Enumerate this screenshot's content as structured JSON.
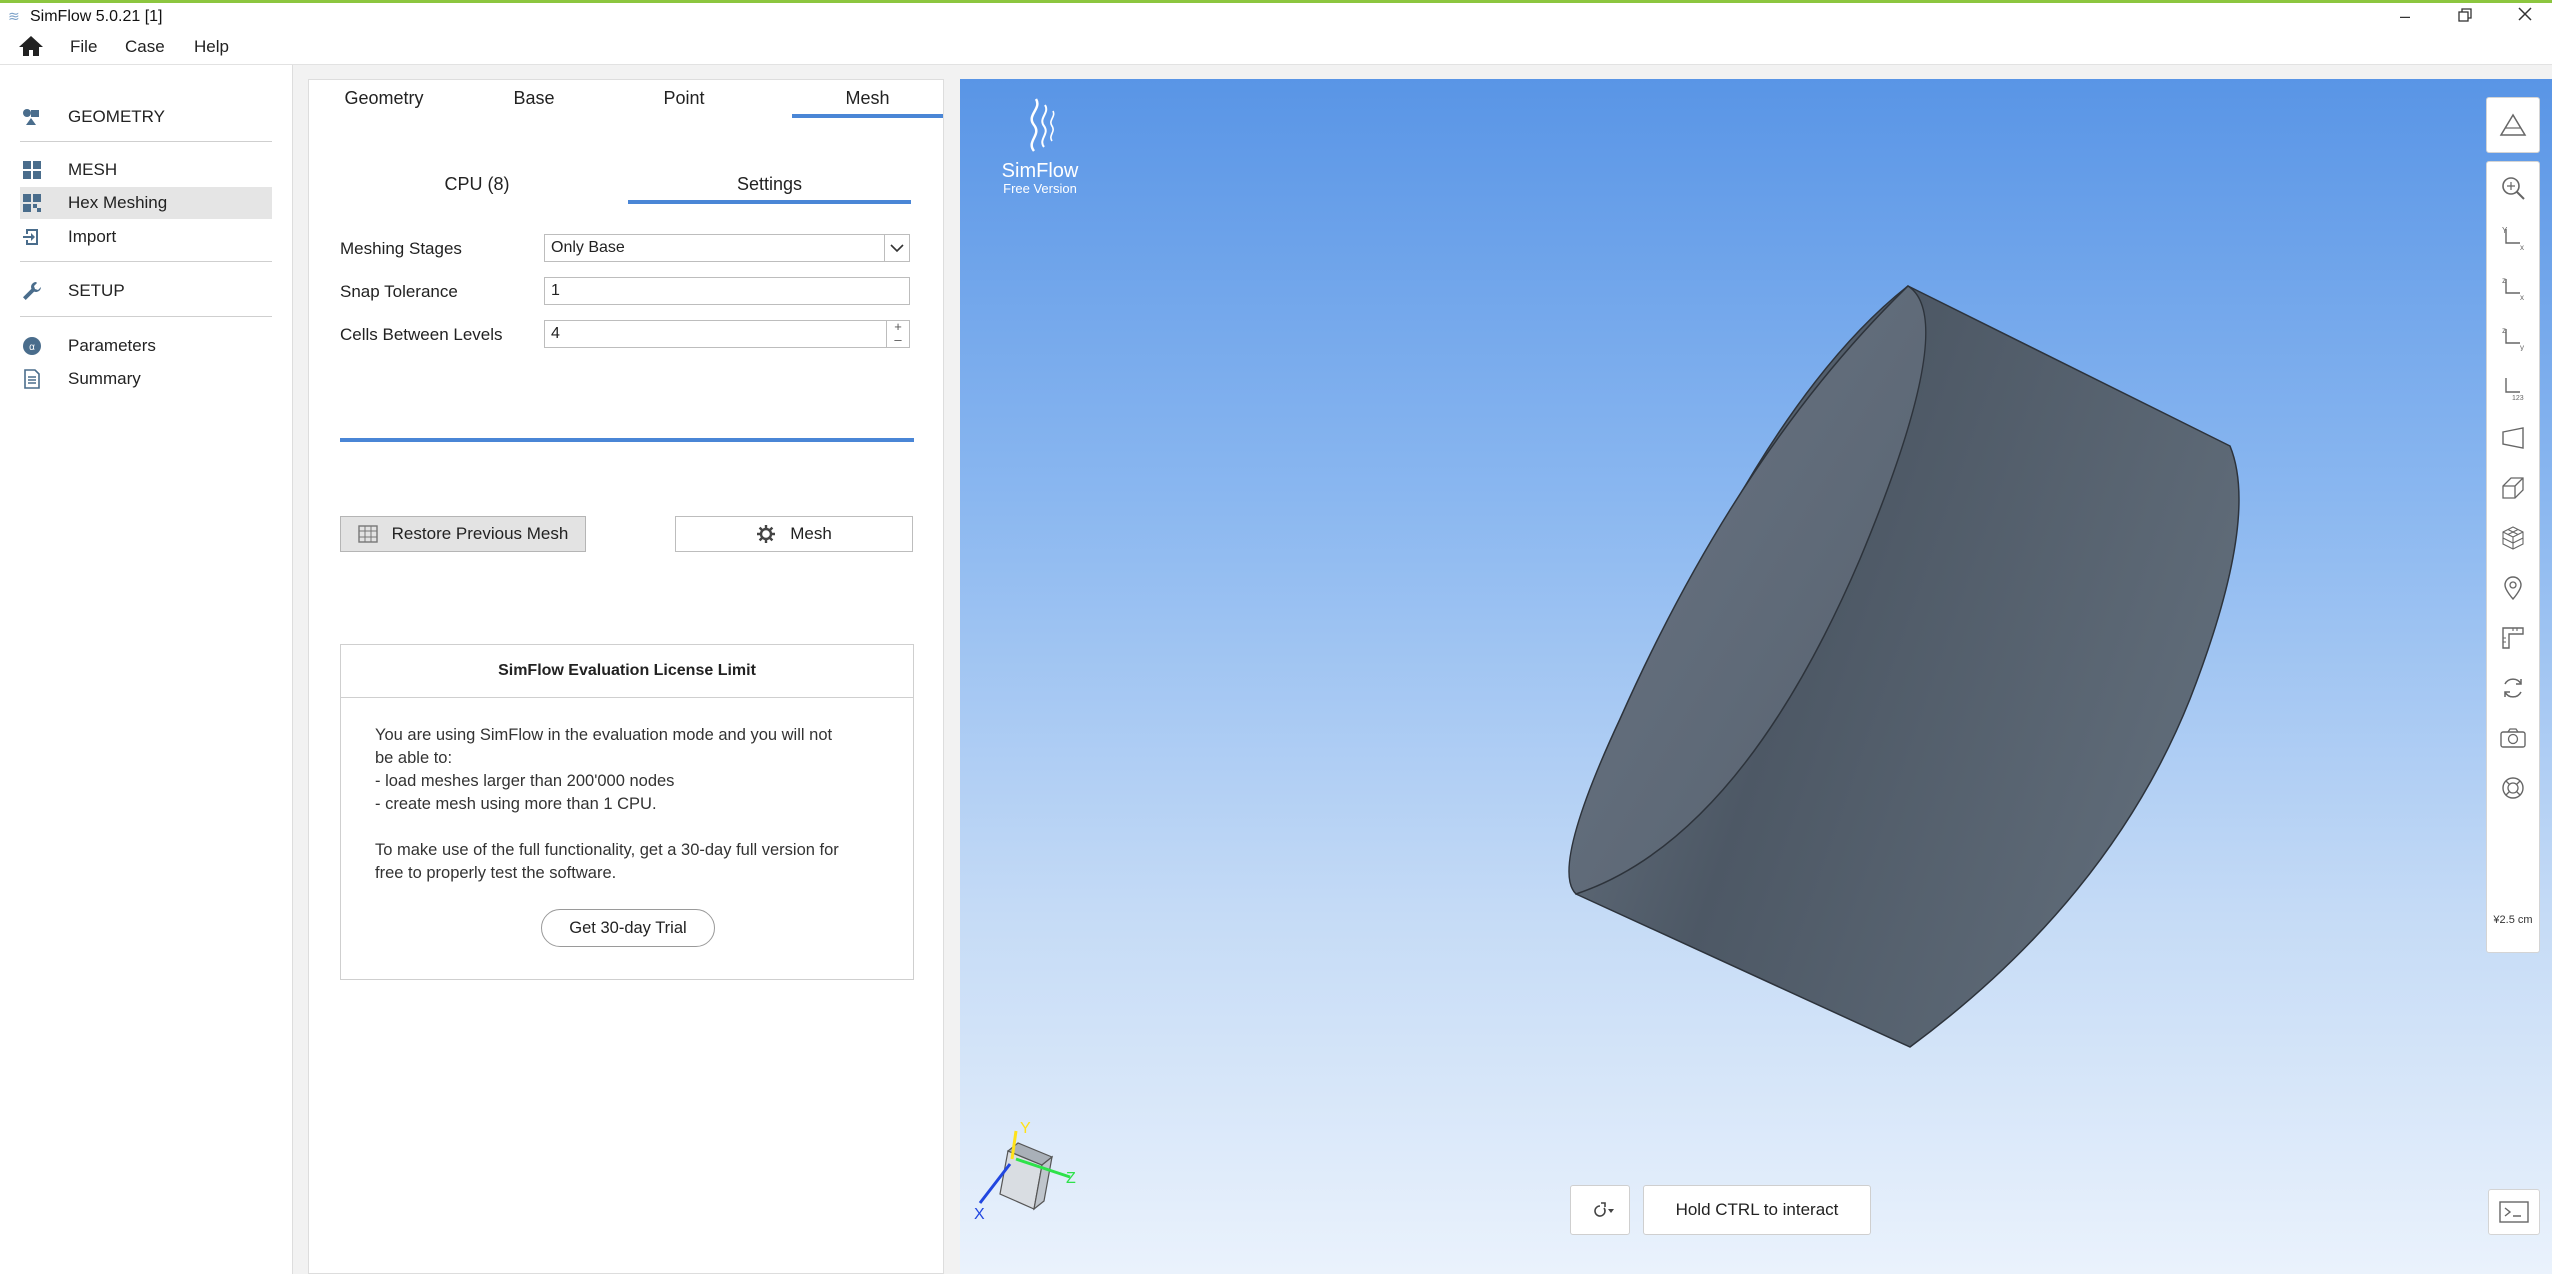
{
  "window": {
    "title": "SimFlow 5.0.21 [1]"
  },
  "menu": {
    "items": [
      "File",
      "Case",
      "Help"
    ]
  },
  "sidebar": {
    "items": [
      {
        "label": "GEOMETRY",
        "icon": "geometry-icon"
      },
      {
        "label": "MESH",
        "icon": "mesh-grid-icon"
      },
      {
        "label": "Hex Meshing",
        "icon": "hex-meshing-icon"
      },
      {
        "label": "Import",
        "icon": "import-icon"
      },
      {
        "label": "SETUP",
        "icon": "wrench-icon"
      },
      {
        "label": "Parameters",
        "icon": "parameters-icon"
      },
      {
        "label": "Summary",
        "icon": "document-icon"
      }
    ]
  },
  "tabs": [
    "Geometry",
    "Base",
    "Point",
    "Mesh"
  ],
  "subtabs": [
    "CPU  (8)",
    "Settings"
  ],
  "form": {
    "meshing_stages_label": "Meshing Stages",
    "meshing_stages_value": "Only Base",
    "snap_tolerance_label": "Snap Tolerance",
    "snap_tolerance_value": "1",
    "cells_between_levels_label": "Cells Between Levels",
    "cells_between_levels_value": "4"
  },
  "buttons": {
    "restore": "Restore Previous Mesh",
    "mesh": "Mesh"
  },
  "license": {
    "title": "SimFlow Evaluation License Limit",
    "lines": [
      "You are using SimFlow in the evaluation mode and you will not",
      "be able to:",
      "- load meshes larger than 200'000 nodes",
      "- create mesh using more than 1 CPU.",
      "",
      "To make use of the full functionality, get a 30-day full version for",
      "free to properly test the software."
    ],
    "trial_button": "Get 30-day Trial"
  },
  "viewport": {
    "logo_name": "SimFlow",
    "logo_version": "Free Version",
    "scale_label": "¥2.5 cm",
    "hold_ctrl": "Hold CTRL to interact",
    "triad": {
      "y": "Y",
      "z": "Z",
      "x": "X"
    },
    "toolbar_icons": [
      "perspective-icon",
      "zoom-fit-icon",
      "view-xy-icon",
      "view-zx-icon",
      "view-zy-icon",
      "axes-123-icon",
      "plane-icon",
      "edges-icon",
      "wireframe-cube-icon",
      "location-pin-icon",
      "ruler-icon",
      "rotate-icon",
      "camera-icon",
      "lifebuoy-icon"
    ]
  },
  "colors": {
    "accent": "#4a86d6",
    "viewport_top": "#5995e6",
    "viewport_bottom": "#eaf2fc",
    "title_border": "#8cc63f"
  }
}
